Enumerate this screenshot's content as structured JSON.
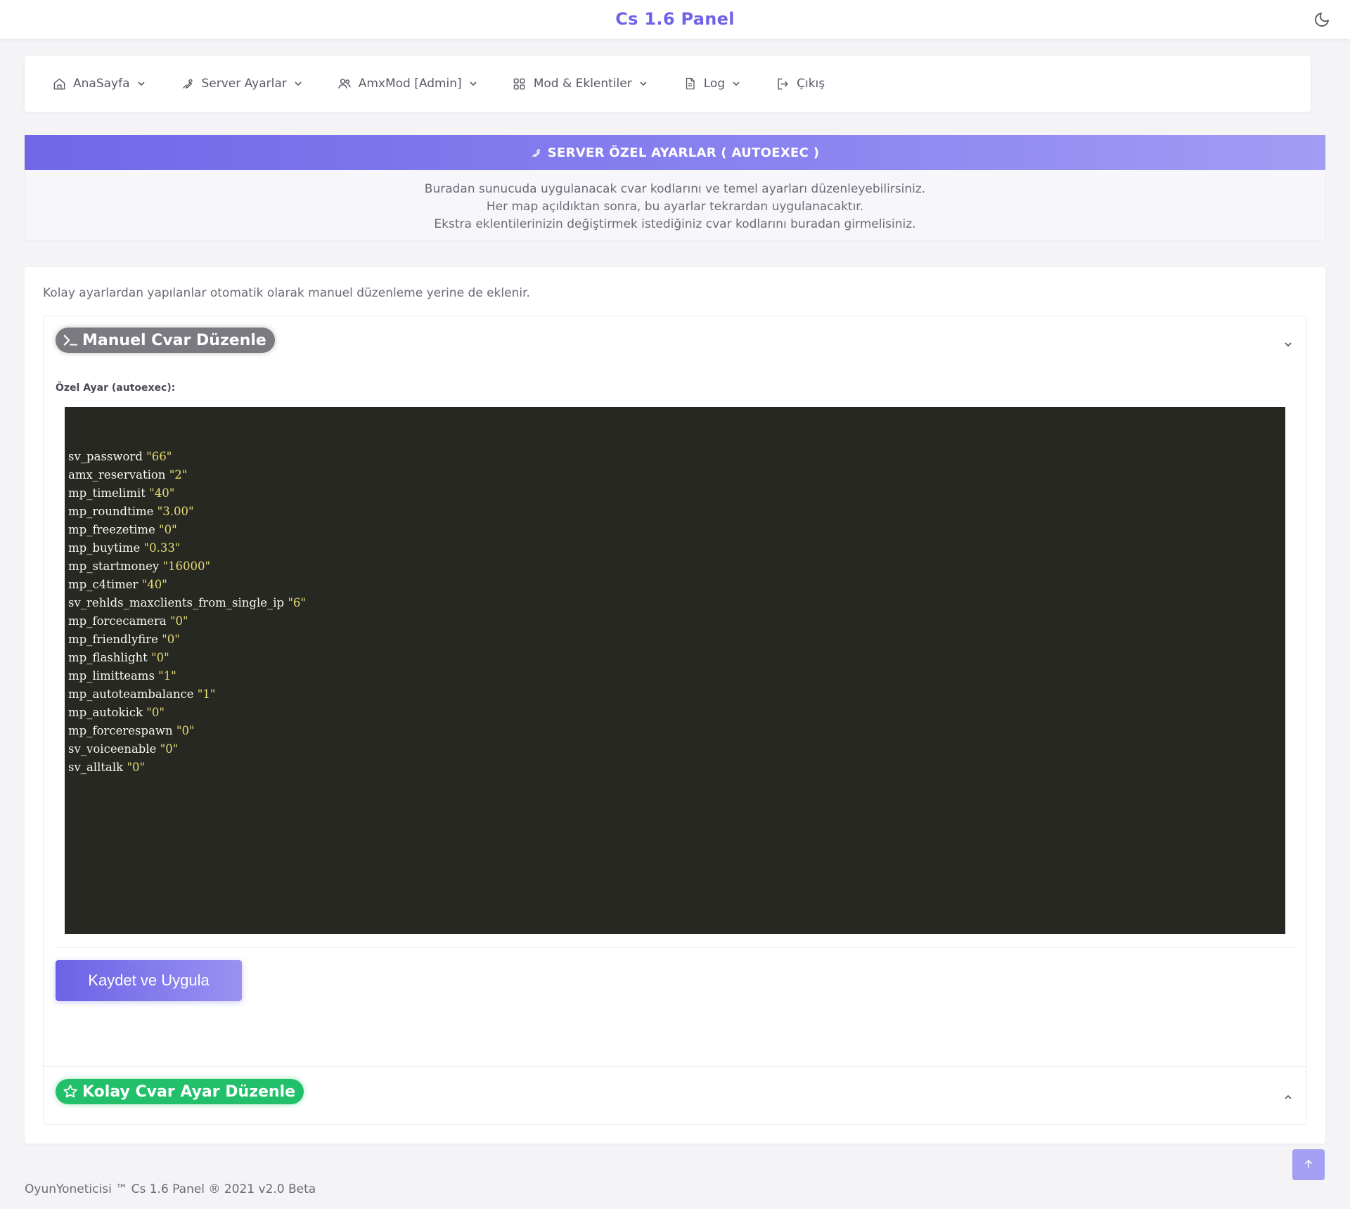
{
  "app": {
    "title": "Cs 1.6 Panel"
  },
  "nav": {
    "items": [
      {
        "label": "AnaSayfa",
        "icon": "home-icon"
      },
      {
        "label": "Server Ayarlar",
        "icon": "wrench-icon"
      },
      {
        "label": "AmxMod [Admin]",
        "icon": "users-icon"
      },
      {
        "label": "Mod & Eklentiler",
        "icon": "puzzle-icon"
      },
      {
        "label": "Log",
        "icon": "file-icon"
      },
      {
        "label": "Çıkış",
        "icon": "logout-icon"
      }
    ]
  },
  "banner": {
    "title": "SERVER ÖZEL AYARLAR ( AUTOEXEC )",
    "lines": [
      "Buradan sunucuda uygulanacak cvar kodlarını ve temel ayarları düzenleyebilirsiniz.",
      "Her map açıldıktan sonra, bu ayarlar tekrardan uygulanacaktır.",
      "Ekstra eklentilerinizin değiştirmek istediğiniz cvar kodlarını buradan girmelisiniz."
    ]
  },
  "main": {
    "note": "Kolay ayarlardan yapılanlar otomatik olarak manuel düzenleme yerine de eklenir.",
    "manual_title": "Manuel Cvar Düzenle",
    "field_label": "Özel Ayar (autoexec):",
    "cvars": [
      {
        "name": "sv_password",
        "value": "\"66\""
      },
      {
        "name": "amx_reservation",
        "value": "\"2\""
      },
      {
        "name": "mp_timelimit",
        "value": "\"40\""
      },
      {
        "name": "mp_roundtime",
        "value": "\"3.00\""
      },
      {
        "name": "mp_freezetime",
        "value": "\"0\""
      },
      {
        "name": "mp_buytime",
        "value": "\"0.33\""
      },
      {
        "name": "mp_startmoney",
        "value": "\"16000\""
      },
      {
        "name": "mp_c4timer",
        "value": "\"40\""
      },
      {
        "name": "sv_rehlds_maxclients_from_single_ip",
        "value": "\"6\""
      },
      {
        "name": "mp_forcecamera",
        "value": "\"0\""
      },
      {
        "name": "mp_friendlyfire",
        "value": "\"0\""
      },
      {
        "name": "mp_flashlight",
        "value": "\"0\""
      },
      {
        "name": "mp_limitteams",
        "value": "\"1\""
      },
      {
        "name": "mp_autoteambalance",
        "value": "\"1\""
      },
      {
        "name": "mp_autokick",
        "value": "\"0\""
      },
      {
        "name": "mp_forcerespawn",
        "value": "\"0\""
      },
      {
        "name": "sv_voiceenable",
        "value": "\"0\""
      },
      {
        "name": "sv_alltalk",
        "value": "\"0\""
      }
    ],
    "save_label": "Kaydet ve Uygula",
    "easy_title": "Kolay Cvar Ayar Düzenle"
  },
  "footer": {
    "text": "OyunYoneticisi ™ Cs 1.6 Panel ® 2021 v2.0 Beta"
  },
  "colors": {
    "accent": "#7067e8",
    "success": "#22c06a",
    "editor_bg": "#272822",
    "string": "#e6db74"
  }
}
